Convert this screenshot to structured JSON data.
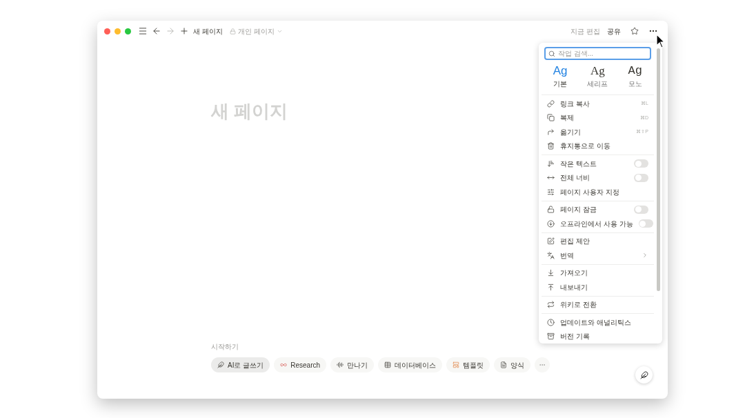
{
  "titlebar": {
    "page_title": "새 페이지",
    "location": "개인 페이지",
    "edit_status": "지금 편집",
    "share": "공유"
  },
  "page": {
    "title": "새 페이지",
    "start_label": "시작하기",
    "chips": [
      {
        "label": "AI로 글쓰기",
        "selected": true
      },
      {
        "label": "Research",
        "selected": false
      },
      {
        "label": "만나기",
        "selected": false
      },
      {
        "label": "데이터베이스",
        "selected": false
      },
      {
        "label": "템플릿",
        "selected": false
      },
      {
        "label": "양식",
        "selected": false
      }
    ]
  },
  "menu": {
    "search": {
      "placeholder": "작업 검색..."
    },
    "fonts": [
      {
        "sample": "Ag",
        "label": "기본",
        "selected": true
      },
      {
        "sample": "Ag",
        "label": "세리프",
        "selected": false
      },
      {
        "sample": "Ag",
        "label": "모노",
        "selected": false
      }
    ],
    "groups": [
      [
        {
          "kind": "action",
          "label": "링크 복사",
          "shortcut": "⌘L"
        },
        {
          "kind": "action",
          "label": "복제",
          "shortcut": "⌘D"
        },
        {
          "kind": "action",
          "label": "옮기기",
          "shortcut": "⌘⇧P"
        },
        {
          "kind": "action",
          "label": "휴지통으로 이동"
        }
      ],
      [
        {
          "kind": "toggle",
          "label": "작은 텍스트",
          "on": false
        },
        {
          "kind": "toggle",
          "label": "전체 너비",
          "on": false
        },
        {
          "kind": "action",
          "label": "페이지 사용자 지정"
        }
      ],
      [
        {
          "kind": "toggle",
          "label": "페이지 잠금",
          "on": false
        },
        {
          "kind": "toggle",
          "label": "오프라인에서 사용 가능",
          "on": false
        }
      ],
      [
        {
          "kind": "action",
          "label": "편집 제안"
        },
        {
          "kind": "submenu",
          "label": "번역"
        }
      ],
      [
        {
          "kind": "action",
          "label": "가져오기"
        },
        {
          "kind": "action",
          "label": "내보내기"
        }
      ],
      [
        {
          "kind": "action",
          "label": "위키로 전환"
        }
      ],
      [
        {
          "kind": "action",
          "label": "업데이트와 애널리틱스"
        },
        {
          "kind": "action",
          "label": "버전 기록"
        }
      ]
    ]
  }
}
